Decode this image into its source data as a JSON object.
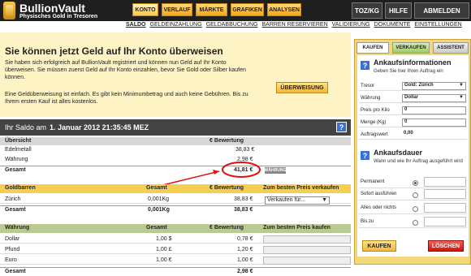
{
  "header": {
    "brand": "BullionVault",
    "tagline": "Physisches Gold in Tresoren",
    "nav": [
      "KONTO",
      "VERLAUF",
      "MÄRKTE",
      "GRAFIKEN",
      "ANALYSEN"
    ],
    "right": {
      "unit": "TOZ/KG",
      "help": "HILFE",
      "logout": "ABMELDEN"
    }
  },
  "subnav": [
    "SALDO",
    "GELDEINZAHLUNG",
    "GELDABBUCHUNG",
    "BARREN RESERVIEREN",
    "VALIDIERUNG",
    "DOKUMENTE",
    "EINSTELLUNGEN"
  ],
  "notice": {
    "title": "Sie können jetzt Geld auf Ihr Konto überweisen",
    "p1": "Sie haben sich erfolgreich auf BullionVault registriert und können nun Geld auf Ihr Konto überweisen. Sie müssen zuerst Geld auf Ihr Konto einzahlen, bevor Sie Gold oder Silber kaufen können.",
    "p2": "Eine Geldüberweisung ist einfach. Es gibt kein Minimumbetrag und auch keine Gebühren. Bis zu Ihrem ersten Kauf ist alles kostenlos.",
    "button": "ÜBERWEISUNG"
  },
  "saldo": {
    "label": "Ihr Saldo am",
    "date": "1. Januar 2012 21:35:45 MEZ",
    "help": "?"
  },
  "overview": {
    "header": {
      "name": "Übersicht",
      "value": "€ Bewertung"
    },
    "rows": [
      {
        "name": "Edelmetall",
        "value": "38,83 €"
      },
      {
        "name": "Währung",
        "value": "2,98 €"
      }
    ],
    "total": {
      "name": "Gesamt",
      "value": "41,81 €",
      "btn": "WÄHRUNG"
    }
  },
  "gold": {
    "header": {
      "name": "Goldbarren",
      "total": "Gesamt",
      "value": "€ Bewertung",
      "action": "Zum besten Preis verkaufen"
    },
    "rows": [
      {
        "name": "Zürich",
        "total": "0,001Kg",
        "value": "38,83 €",
        "select": "Verkaufen für..."
      }
    ],
    "total": {
      "name": "Gesamt",
      "total": "0,001Kg",
      "value": "38,83 €"
    }
  },
  "currency": {
    "header": {
      "name": "Währung",
      "total": "Gesamt",
      "value": "€ Bewertung",
      "action": "Zum besten Preis kaufen"
    },
    "rows": [
      {
        "name": "Dollar",
        "total": "1,00 $",
        "value": "0,78 €"
      },
      {
        "name": "Pfund",
        "total": "1,00 £",
        "value": "1,20 €"
      },
      {
        "name": "Euro",
        "total": "1,00 €",
        "value": "1,00 €"
      }
    ],
    "total": {
      "name": "Gesamt",
      "value": "2,98 €"
    }
  },
  "panel": {
    "tabs": [
      "KAUFEN",
      "VERKAUFEN",
      "ASSISTENT"
    ],
    "info_title": "Ankaufsinformationen",
    "info_sub": "Geben Sie hier Ihren Auftrag ein",
    "fields": [
      {
        "label": "Tresor",
        "value": "Gold: Zürich"
      },
      {
        "label": "Währung",
        "value": "Dollar"
      },
      {
        "label": "Preis pro Kilo",
        "value": "0"
      },
      {
        "label": "Menge (Kg)",
        "value": "0"
      },
      {
        "label": "Auftragswert",
        "value": "0,00"
      }
    ],
    "duration_title": "Ankaufsdauer",
    "duration_sub": "Wann und wie Ihr Auftrag ausgeführt wird",
    "options": [
      "Permanent",
      "Sofort ausführen",
      "Alles oder nichts",
      "Bis zu"
    ],
    "buy": "KAUFEN",
    "delete": "LÖSCHEN"
  },
  "colors": {
    "gold": "#f6cf52",
    "green": "#b9ca93",
    "dark": "#1f1f1f",
    "red": "#d0150d"
  }
}
